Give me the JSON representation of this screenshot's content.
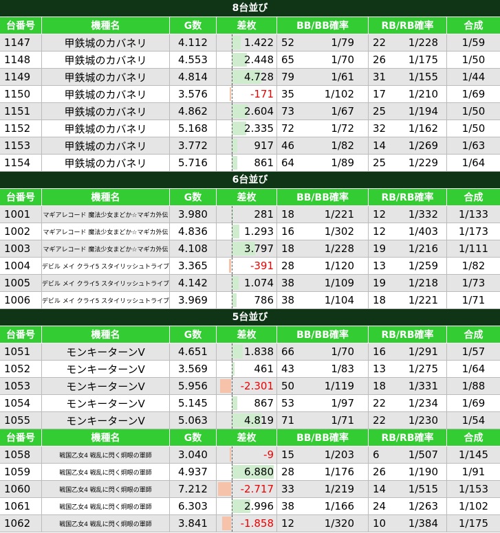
{
  "headers": [
    "台番号",
    "機種名",
    "G数",
    "差枚",
    "BB/BB確率",
    "RB/RB確率",
    "合成"
  ],
  "groups": [
    {
      "title": "8台並び",
      "rows": [
        {
          "no": "1147",
          "name": "甲鉄城のカバネリ",
          "g": "4.112",
          "diff": "1.422",
          "diff_value": 1422,
          "bb": "52",
          "bbr": "1/79",
          "rb": "22",
          "rbr": "1/228",
          "total": "1/59"
        },
        {
          "no": "1148",
          "name": "甲鉄城のカバネリ",
          "g": "4.553",
          "diff": "2.448",
          "diff_value": 2448,
          "bb": "65",
          "bbr": "1/70",
          "rb": "26",
          "rbr": "1/175",
          "total": "1/50"
        },
        {
          "no": "1149",
          "name": "甲鉄城のカバネリ",
          "g": "4.814",
          "diff": "4.728",
          "diff_value": 4728,
          "bb": "79",
          "bbr": "1/61",
          "rb": "31",
          "rbr": "1/155",
          "total": "1/44"
        },
        {
          "no": "1150",
          "name": "甲鉄城のカバネリ",
          "g": "3.576",
          "diff": "-171",
          "diff_value": -171,
          "bb": "35",
          "bbr": "1/102",
          "rb": "17",
          "rbr": "1/210",
          "total": "1/69"
        },
        {
          "no": "1151",
          "name": "甲鉄城のカバネリ",
          "g": "4.862",
          "diff": "2.604",
          "diff_value": 2604,
          "bb": "73",
          "bbr": "1/67",
          "rb": "25",
          "rbr": "1/194",
          "total": "1/50"
        },
        {
          "no": "1152",
          "name": "甲鉄城のカバネリ",
          "g": "5.168",
          "diff": "2.335",
          "diff_value": 2335,
          "bb": "72",
          "bbr": "1/72",
          "rb": "32",
          "rbr": "1/162",
          "total": "1/50"
        },
        {
          "no": "1153",
          "name": "甲鉄城のカバネリ",
          "g": "3.772",
          "diff": "917",
          "diff_value": 917,
          "bb": "46",
          "bbr": "1/82",
          "rb": "14",
          "rbr": "1/269",
          "total": "1/63"
        },
        {
          "no": "1154",
          "name": "甲鉄城のカバネリ",
          "g": "5.716",
          "diff": "861",
          "diff_value": 861,
          "bb": "64",
          "bbr": "1/89",
          "rb": "25",
          "rbr": "1/229",
          "total": "1/64"
        }
      ]
    },
    {
      "title": "6台並び",
      "rows": [
        {
          "no": "1001",
          "name": "マギアレコード 魔法少女まどか☆マギカ外伝",
          "small": true,
          "g": "3.980",
          "diff": "281",
          "diff_value": 281,
          "bb": "18",
          "bbr": "1/221",
          "rb": "12",
          "rbr": "1/332",
          "total": "1/133"
        },
        {
          "no": "1002",
          "name": "マギアレコード 魔法少女まどか☆マギカ外伝",
          "small": true,
          "g": "4.836",
          "diff": "1.293",
          "diff_value": 1293,
          "bb": "16",
          "bbr": "1/302",
          "rb": "12",
          "rbr": "1/403",
          "total": "1/173"
        },
        {
          "no": "1003",
          "name": "マギアレコード 魔法少女まどか☆マギカ外伝",
          "small": true,
          "g": "4.108",
          "diff": "3.797",
          "diff_value": 3797,
          "bb": "18",
          "bbr": "1/228",
          "rb": "19",
          "rbr": "1/216",
          "total": "1/111"
        },
        {
          "no": "1004",
          "name": "デビル メイ クライ5 スタイリッシュトライブ",
          "small": true,
          "g": "3.365",
          "diff": "-391",
          "diff_value": -391,
          "bb": "28",
          "bbr": "1/120",
          "rb": "13",
          "rbr": "1/259",
          "total": "1/82"
        },
        {
          "no": "1005",
          "name": "デビル メイ クライ5 スタイリッシュトライブ",
          "small": true,
          "g": "4.142",
          "diff": "1.074",
          "diff_value": 1074,
          "bb": "38",
          "bbr": "1/109",
          "rb": "19",
          "rbr": "1/218",
          "total": "1/73"
        },
        {
          "no": "1006",
          "name": "デビル メイ クライ5 スタイリッシュトライブ",
          "small": true,
          "g": "3.969",
          "diff": "786",
          "diff_value": 786,
          "bb": "38",
          "bbr": "1/104",
          "rb": "18",
          "rbr": "1/221",
          "total": "1/71"
        }
      ]
    },
    {
      "title": "5台並び",
      "rows": [
        {
          "no": "1051",
          "name": "モンキーターンV",
          "g": "4.651",
          "diff": "1.838",
          "diff_value": 1838,
          "bb": "66",
          "bbr": "1/70",
          "rb": "16",
          "rbr": "1/291",
          "total": "1/57"
        },
        {
          "no": "1052",
          "name": "モンキーターンV",
          "g": "3.569",
          "diff": "461",
          "diff_value": 461,
          "bb": "43",
          "bbr": "1/83",
          "rb": "13",
          "rbr": "1/275",
          "total": "1/64"
        },
        {
          "no": "1053",
          "name": "モンキーターンV",
          "g": "5.956",
          "diff": "-2.301",
          "diff_value": -2301,
          "bb": "50",
          "bbr": "1/119",
          "rb": "18",
          "rbr": "1/331",
          "total": "1/88"
        },
        {
          "no": "1054",
          "name": "モンキーターンV",
          "g": "5.145",
          "diff": "867",
          "diff_value": 867,
          "bb": "53",
          "bbr": "1/97",
          "rb": "22",
          "rbr": "1/234",
          "total": "1/69"
        },
        {
          "no": "1055",
          "name": "モンキーターンV",
          "g": "5.063",
          "diff": "4.819",
          "diff_value": 4819,
          "bb": "71",
          "bbr": "1/71",
          "rb": "22",
          "rbr": "1/230",
          "total": "1/54"
        }
      ]
    },
    {
      "title": "",
      "rows": [
        {
          "no": "1058",
          "name": "戦国乙女4 戦乱に閃く炯眼の軍師",
          "small": true,
          "g": "3.040",
          "diff": "-9",
          "diff_value": -9,
          "bb": "15",
          "bbr": "1/203",
          "rb": "6",
          "rbr": "1/507",
          "total": "1/145"
        },
        {
          "no": "1059",
          "name": "戦国乙女4 戦乱に閃く炯眼の軍師",
          "small": true,
          "g": "4.937",
          "diff": "6.880",
          "diff_value": 6880,
          "bb": "28",
          "bbr": "1/176",
          "rb": "26",
          "rbr": "1/190",
          "total": "1/91"
        },
        {
          "no": "1060",
          "name": "戦国乙女4 戦乱に閃く炯眼の軍師",
          "small": true,
          "g": "7.212",
          "diff": "-2.717",
          "diff_value": -2717,
          "bb": "33",
          "bbr": "1/219",
          "rb": "14",
          "rbr": "1/515",
          "total": "1/153"
        },
        {
          "no": "1061",
          "name": "戦国乙女4 戦乱に閃く炯眼の軍師",
          "small": true,
          "g": "6.303",
          "diff": "2.996",
          "diff_value": 2996,
          "bb": "38",
          "bbr": "1/166",
          "rb": "24",
          "rbr": "1/263",
          "total": "1/102"
        },
        {
          "no": "1062",
          "name": "戦国乙女4 戦乱に閃く炯眼の軍師",
          "small": true,
          "g": "3.841",
          "diff": "-1.858",
          "diff_value": -1858,
          "bb": "12",
          "bbr": "1/320",
          "rb": "10",
          "rbr": "1/384",
          "total": "1/175"
        }
      ]
    }
  ]
}
